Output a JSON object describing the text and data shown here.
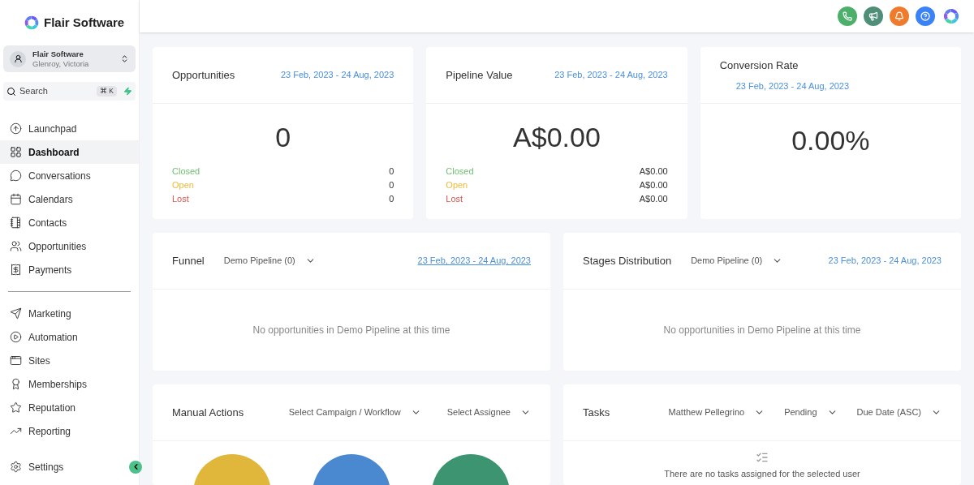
{
  "brand": {
    "name": "Flair Software"
  },
  "account": {
    "name": "Flair Software",
    "location": "Glenroy, Victoria"
  },
  "search": {
    "placeholder": "Search",
    "shortcut": "⌘ K"
  },
  "nav_primary": [
    {
      "label": "Launchpad",
      "selected": false
    },
    {
      "label": "Dashboard",
      "selected": true
    },
    {
      "label": "Conversations",
      "selected": false
    },
    {
      "label": "Calendars",
      "selected": false
    },
    {
      "label": "Contacts",
      "selected": false
    },
    {
      "label": "Opportunities",
      "selected": false
    },
    {
      "label": "Payments",
      "selected": false
    }
  ],
  "nav_secondary": [
    {
      "label": "Marketing",
      "selected": false
    },
    {
      "label": "Automation",
      "selected": false
    },
    {
      "label": "Sites",
      "selected": false
    },
    {
      "label": "Memberships",
      "selected": false
    },
    {
      "label": "Reputation",
      "selected": false
    },
    {
      "label": "Reporting",
      "selected": false
    }
  ],
  "settings": {
    "label": "Settings"
  },
  "stat_cards": [
    {
      "title": "Opportunities",
      "date_range": "23 Feb, 2023 - 24 Aug, 2023",
      "value": "0",
      "breakdown": [
        {
          "label": "Closed",
          "value": "0",
          "color": "#6cc070"
        },
        {
          "label": "Open",
          "value": "0",
          "color": "#f0b93a"
        },
        {
          "label": "Lost",
          "value": "0",
          "color": "#d9534f"
        }
      ]
    },
    {
      "title": "Pipeline Value",
      "date_range": "23 Feb, 2023 - 24 Aug, 2023",
      "value": "A$0.00",
      "breakdown": [
        {
          "label": "Closed",
          "value": "A$0.00",
          "color": "#6cc070"
        },
        {
          "label": "Open",
          "value": "A$0.00",
          "color": "#f0b93a"
        },
        {
          "label": "Lost",
          "value": "A$0.00",
          "color": "#d9534f"
        }
      ]
    },
    {
      "title": "Conversion Rate",
      "date_range": "23 Feb, 2023 - 24 Aug, 2023",
      "value": "0.00%"
    }
  ],
  "pipeline_panels": [
    {
      "title": "Funnel",
      "pipeline": "Demo Pipeline (0)",
      "date_range": "23 Feb, 2023 - 24 Aug, 2023",
      "date_underlined": true,
      "empty_message": "No opportunities in Demo Pipeline at this time"
    },
    {
      "title": "Stages Distribution",
      "pipeline": "Demo Pipeline (0)",
      "date_range": "23 Feb, 2023 - 24 Aug, 2023",
      "date_underlined": false,
      "empty_message": "No opportunities in Demo Pipeline at this time"
    }
  ],
  "manual_actions": {
    "title": "Manual Actions",
    "filters": [
      "Select Campaign / Workflow",
      "Select Assignee"
    ]
  },
  "tasks": {
    "title": "Tasks",
    "filters": [
      "Matthew Pellegrino",
      "Pending",
      "Due Date (ASC)"
    ],
    "empty_message": "There are no tasks assigned for the selected user"
  }
}
